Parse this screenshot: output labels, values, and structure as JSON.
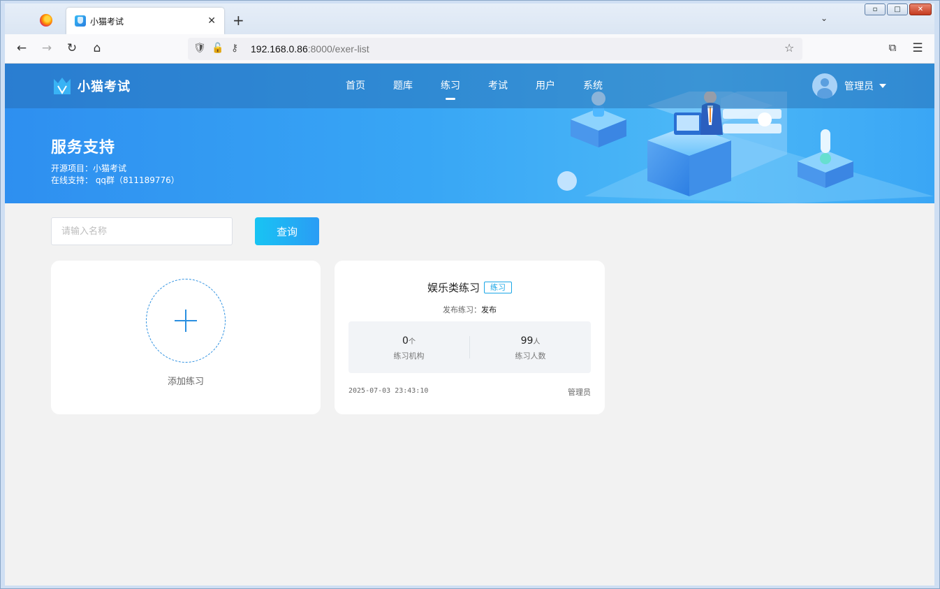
{
  "browser": {
    "tab_title": "小猫考试",
    "tab_close": "✕",
    "new_tab": "+",
    "url_host": "192.168.0.86",
    "url_rest": ":8000/exer-list",
    "window_controls": [
      "minimize",
      "maximize",
      "close"
    ]
  },
  "app": {
    "logo_text": "小猫考试",
    "menu": [
      {
        "label": "首页",
        "active": false
      },
      {
        "label": "题库",
        "active": false
      },
      {
        "label": "练习",
        "active": true
      },
      {
        "label": "考试",
        "active": false
      },
      {
        "label": "用户",
        "active": false
      },
      {
        "label": "系统",
        "active": false
      }
    ],
    "user_name": "管理员"
  },
  "banner": {
    "title": "服务支持",
    "line1": "开源项目：小猫考试",
    "line2": "在线支持： qq群（811189776）"
  },
  "search": {
    "placeholder": "请输入名称",
    "value": "",
    "button_label": "查询"
  },
  "add_card": {
    "label": "添加练习"
  },
  "exercise_card": {
    "title": "娱乐类练习",
    "tag": "练习",
    "publish_label": "发布练习：",
    "publish_value": "发布",
    "stats": [
      {
        "value": "0",
        "unit": "个",
        "label": "练习机构"
      },
      {
        "value": "99",
        "unit": "人",
        "label": "练习人数"
      }
    ],
    "time": "2025-07-03 23:43:10",
    "owner": "管理员"
  },
  "colors": {
    "accent": "#2a8fe0",
    "button_start": "#18c4f3",
    "button_end": "#2a9cf5",
    "tag": "#19a6e6"
  }
}
